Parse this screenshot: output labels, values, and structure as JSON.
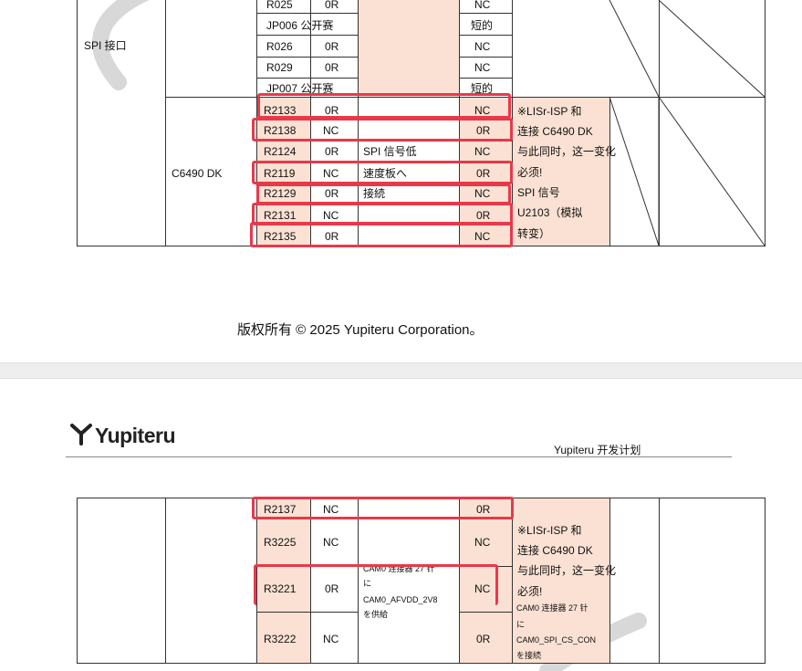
{
  "page1": {
    "section_label": "SPI 接口",
    "group_label": "C6490 DK",
    "top_rows": [
      {
        "ref": "R025",
        "val": "0R",
        "right": "NC"
      },
      {
        "ref": "JP006 公开赛",
        "val": "",
        "right": "短的"
      },
      {
        "ref": "R026",
        "val": "0R",
        "right": "NC"
      },
      {
        "ref": "R029",
        "val": "0R",
        "right": "NC"
      },
      {
        "ref": "JP007 公开赛",
        "val": "",
        "right": "短的"
      }
    ],
    "c6490_rows": [
      {
        "ref": "R2133",
        "val": "0R",
        "note": "",
        "right": "NC"
      },
      {
        "ref": "R2138",
        "val": "NC",
        "note": "",
        "right": "0R"
      },
      {
        "ref": "R2124",
        "val": "0R",
        "note": "SPI 信号低",
        "right": "NC"
      },
      {
        "ref": "R2119",
        "val": "NC",
        "note": "速度板へ",
        "right": "0R"
      },
      {
        "ref": "R2129",
        "val": "0R",
        "note": "接続",
        "right": "NC"
      },
      {
        "ref": "R2131",
        "val": "NC",
        "note": "",
        "right": "0R"
      },
      {
        "ref": "R2135",
        "val": "0R",
        "note": "",
        "right": "NC"
      }
    ],
    "remark_lines": [
      "※LISr-ISP 和",
      "连接 C6490 DK",
      "与此同时，这一变化",
      "必须!",
      "SPI 信号",
      "U2103（模拟",
      "转变）"
    ],
    "copyright": "版权所有 © 2025 Yupiteru Corporation。"
  },
  "page2": {
    "logo_text": "Yupiteru",
    "header_right": "Yupiteru 开发计划",
    "rows": [
      {
        "ref": "R2137",
        "val": "NC",
        "right": "0R"
      },
      {
        "ref": "R3225",
        "val": "NC",
        "right": "NC"
      },
      {
        "ref": "R3221",
        "val": "0R",
        "right": "NC"
      },
      {
        "ref": "R3222",
        "val": "NC",
        "right": "0R"
      }
    ],
    "note_lines": [
      "CAM0 连接器 27 针",
      "に",
      "CAM0_AFVDD_2V8",
      "を供給"
    ],
    "remark_lines": [
      "※LISr-ISP 和",
      "连接 C6490 DK",
      "与此同时，这一变化",
      "必须!"
    ],
    "remark_small_lines": [
      "CAM0 连接器 27 针",
      "に",
      "CAM0_SPI_CS_CON",
      "を接続"
    ]
  },
  "colors": {
    "highlight": "#e8394a",
    "peach": "#fbe1d3"
  }
}
